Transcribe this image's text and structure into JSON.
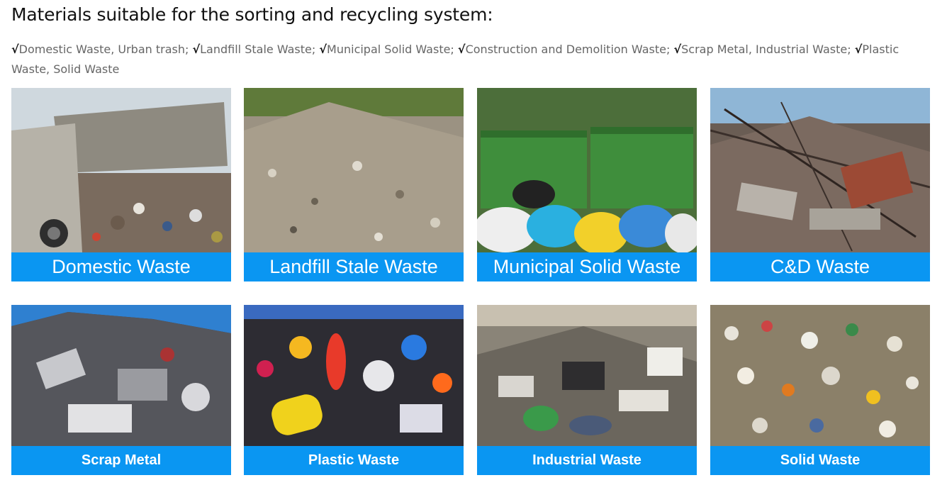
{
  "heading": "Materials suitable for the sorting and recycling system:",
  "materials": [
    {
      "check": "√",
      "text": "Domestic Waste, Urban trash;"
    },
    {
      "check": "√",
      "text": "Landfill Stale Waste;"
    },
    {
      "check": "√",
      "text": "Municipal Solid Waste;"
    },
    {
      "check": "√",
      "text": "Construction and Demolition Waste;"
    },
    {
      "check": "√",
      "text": "Scrap Metal, Industrial Waste;"
    },
    {
      "check": "√",
      "text": "Plastic Waste, Solid Waste"
    }
  ],
  "cards": [
    {
      "label": "Domestic Waste"
    },
    {
      "label": "Landfill Stale Waste"
    },
    {
      "label": "Municipal Solid Waste"
    },
    {
      "label": "C&D Waste"
    },
    {
      "label": "Scrap Metal"
    },
    {
      "label": "Plastic Waste"
    },
    {
      "label": "Industrial Waste"
    },
    {
      "label": "Solid Waste"
    }
  ],
  "colors": {
    "label_bg": "#0a96f2",
    "label_text": "#ffffff"
  }
}
